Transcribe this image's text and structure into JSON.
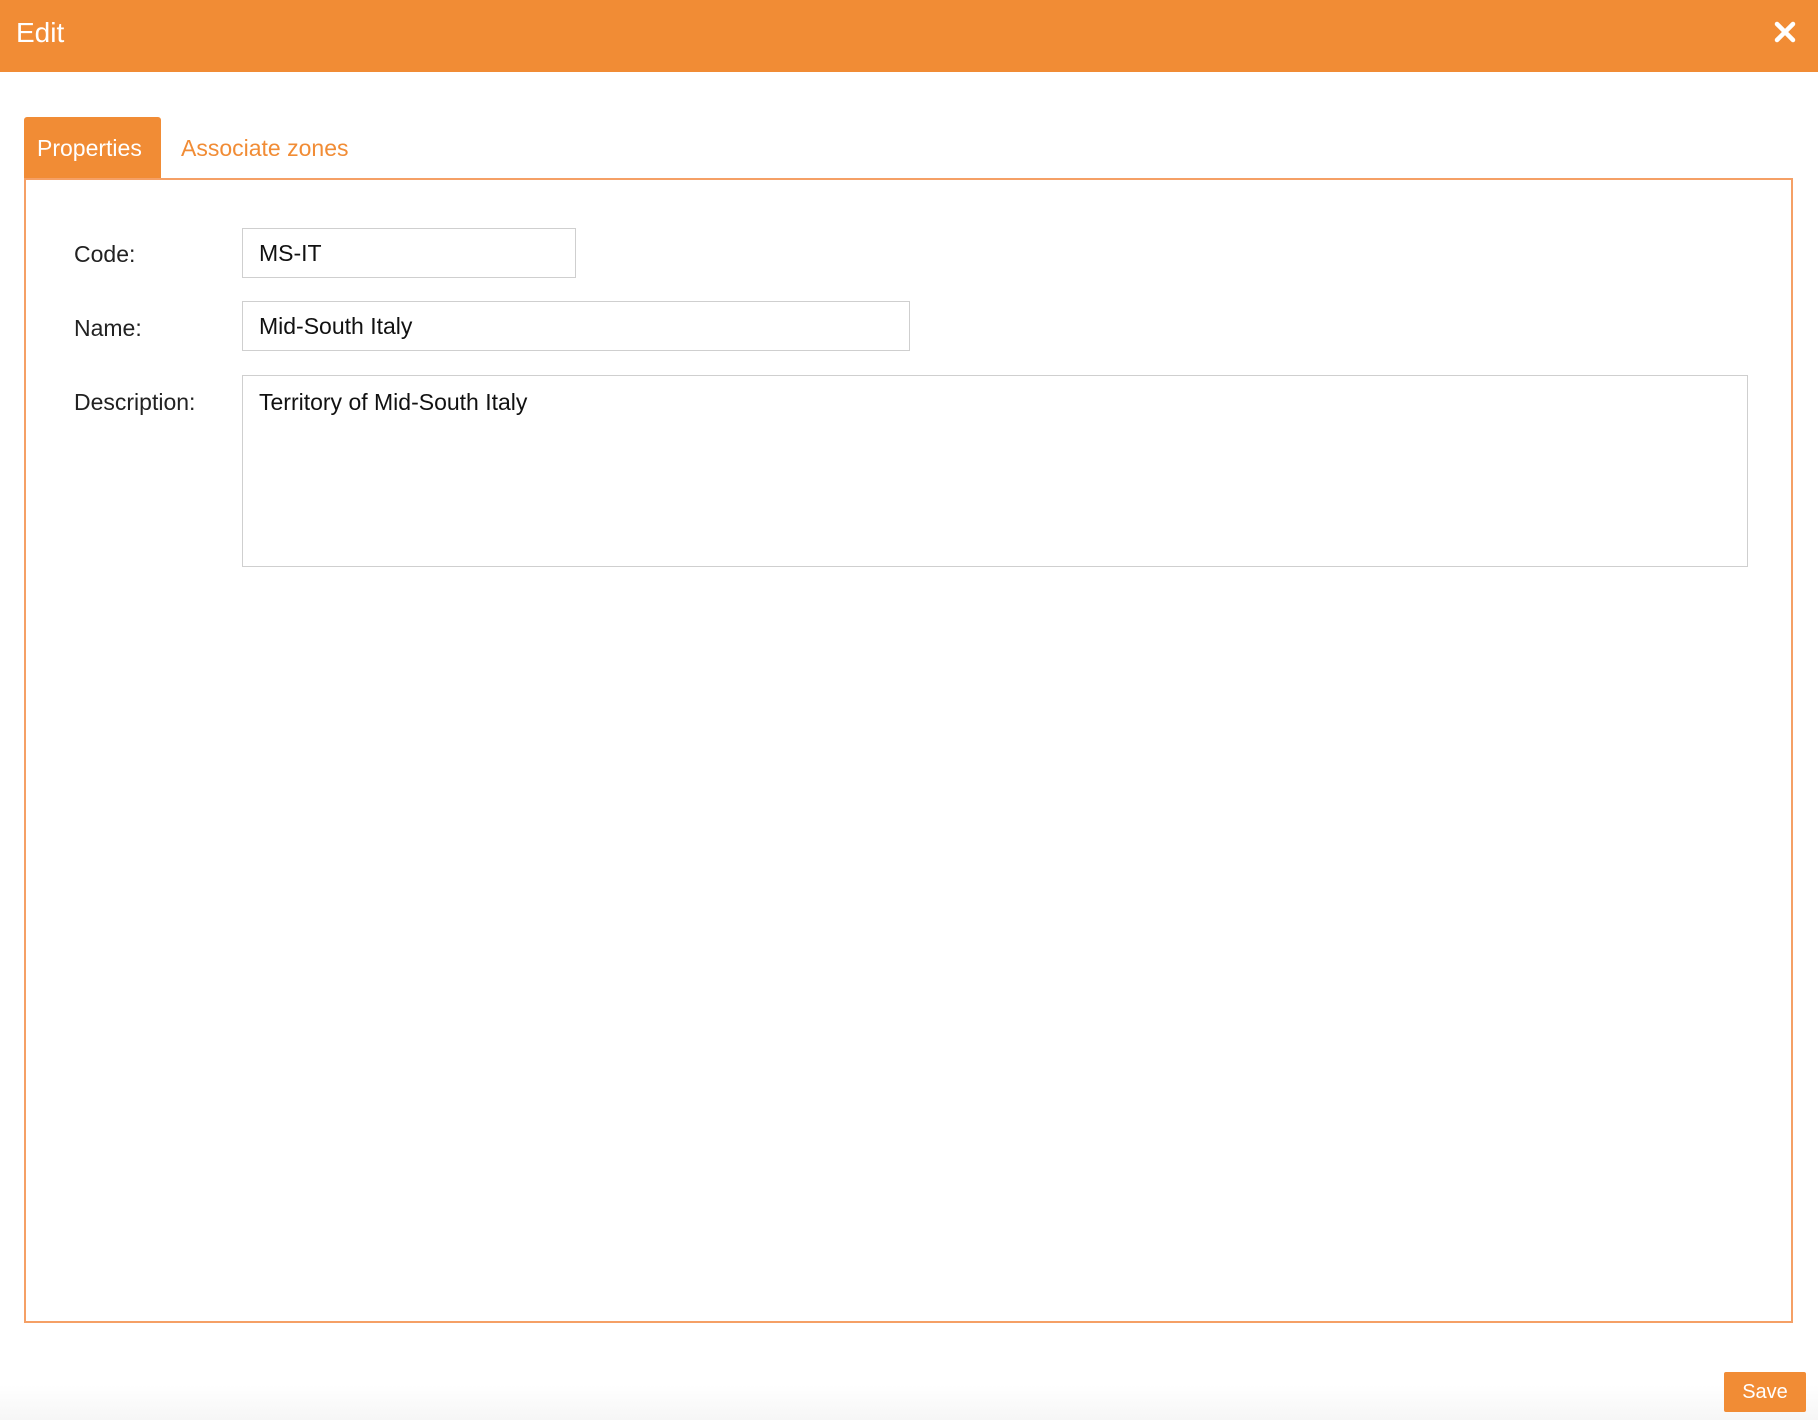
{
  "dialog": {
    "title": "Edit",
    "close_icon": "close-icon",
    "accent_color": "#f18c35"
  },
  "tabs": [
    {
      "label": "Properties",
      "active": true
    },
    {
      "label": "Associate zones",
      "active": false
    }
  ],
  "form": {
    "code": {
      "label": "Code:",
      "value": "MS-IT"
    },
    "name": {
      "label": "Name:",
      "value": "Mid-South Italy"
    },
    "description": {
      "label": "Description:",
      "value": "Territory of Mid-South Italy"
    }
  },
  "footer": {
    "save_label": "Save"
  }
}
